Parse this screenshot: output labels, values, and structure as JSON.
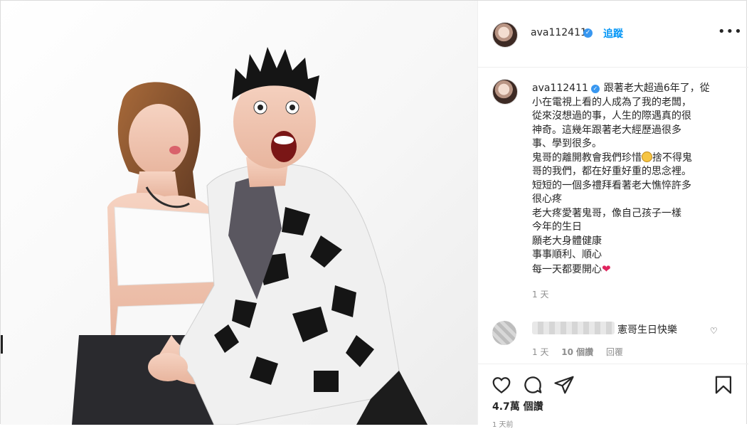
{
  "post": {
    "username": "ava112411",
    "follow_label": "追蹤",
    "separator": "•",
    "more_label": "•••",
    "caption_html_lines": [
      "跟著老大超過6年了，從",
      "小在電視上看的人成為了我的老闆，",
      "從來沒想過的事，人生的際遇真的很",
      "神奇。這幾年跟著老大經歷過很多",
      "事、學到很多。",
      "鬼哥的離開教會我們珍惜",
      "捨不得鬼",
      "哥的我們，都在好重好重的思念裡。",
      "短短的一個多禮拜看著老大憔悴許多",
      "很心疼",
      "老大疼愛著鬼哥，像自己孩子一樣",
      "今年的生日",
      "願老大身體健康",
      "事事順利、順心",
      "每一天都要開心"
    ],
    "caption_age": "1 天",
    "comment": {
      "text": "憲哥生日快樂",
      "age": "1 天",
      "likes": "10 個讚",
      "reply_label": "回覆"
    },
    "like_count": "4.7萬 個讚",
    "post_date": "1 天前"
  },
  "icons": {
    "verified": "verified-badge-icon",
    "heart": "heart-icon",
    "comment": "comment-icon",
    "share": "share-icon",
    "save": "bookmark-icon"
  },
  "colors": {
    "link_blue": "#0095f6",
    "verified_blue": "#3897f0",
    "heart_red": "#e0245e",
    "muted_text": "#8e8e8e"
  }
}
